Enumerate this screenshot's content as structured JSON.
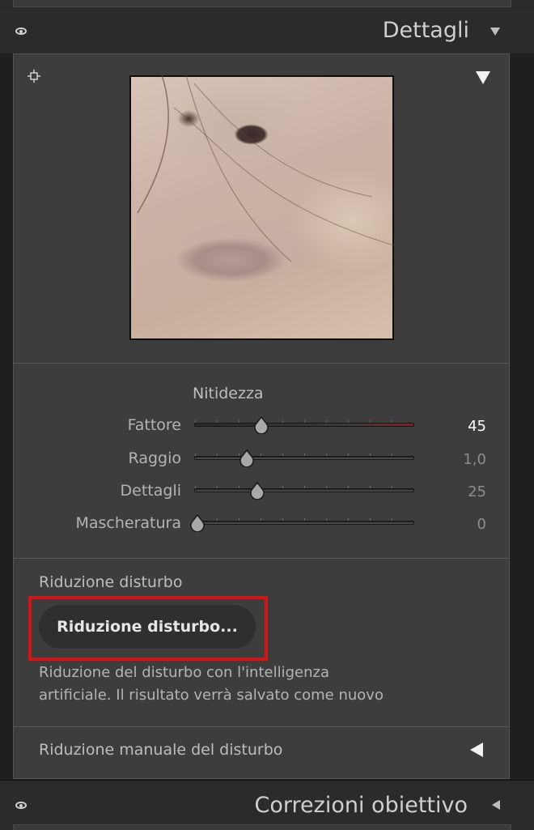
{
  "details_panel": {
    "title": "Dettagli",
    "sharpening": {
      "heading": "Nitidezza",
      "sliders": [
        {
          "label": "Fattore",
          "value": "45",
          "level": 0.3
        },
        {
          "label": "Raggio",
          "value": "1,0",
          "level": 0.23
        },
        {
          "label": "Dettagli",
          "value": "25",
          "level": 0.28
        },
        {
          "label": "Mascheratura",
          "value": "0",
          "level": 0.0
        }
      ]
    },
    "noise_reduction": {
      "heading": "Riduzione disturbo",
      "button_label": "Riduzione disturbo...",
      "description_line1": "Riduzione del disturbo con l'intelligenza",
      "description_line2": "artificiale. Il risultato verrà salvato come nuovo",
      "manual_label": "Riduzione manuale del disturbo"
    }
  },
  "lens_corrections_panel": {
    "title": "Correzioni obiettivo"
  },
  "icons": [
    "eye-icon",
    "triangle-down-icon",
    "triangle-left-icon",
    "target-crosshair-icon"
  ],
  "colors": {
    "panel_bg": "#3d3d3d",
    "header_bg": "#2b2b2b",
    "highlight_box": "#d51414",
    "active_value": "#ffffff"
  }
}
